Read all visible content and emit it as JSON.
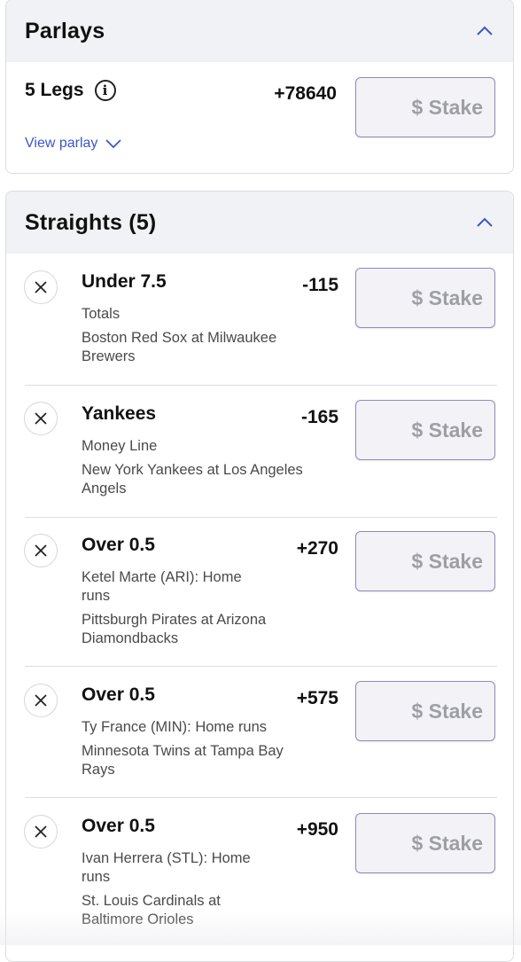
{
  "parlays": {
    "title": "Parlays",
    "legs_label": "5 Legs",
    "info_glyph": "i",
    "odds": "+78640",
    "stake_placeholder": "$ Stake",
    "view_parlay_label": "View parlay"
  },
  "straights": {
    "title": "Straights (5)",
    "bets": [
      {
        "selection": "Under 7.5",
        "market": "Totals",
        "event": "Boston Red Sox at Milwaukee Brewers",
        "odds": "-115",
        "stake_placeholder": "$ Stake"
      },
      {
        "selection": "Yankees",
        "market": "Money Line",
        "event": "New York Yankees at Los Angeles Angels",
        "odds": "-165",
        "stake_placeholder": "$ Stake"
      },
      {
        "selection": "Over 0.5",
        "market": "Ketel Marte (ARI): Home runs",
        "event": "Pittsburgh Pirates at Arizona Diamondbacks",
        "odds": "+270",
        "stake_placeholder": "$ Stake"
      },
      {
        "selection": "Over 0.5",
        "market": "Ty France (MIN): Home runs",
        "event": "Minnesota Twins at Tampa Bay Rays",
        "odds": "+575",
        "stake_placeholder": "$ Stake"
      },
      {
        "selection": "Over 0.5",
        "market": "Ivan Herrera (STL): Home runs",
        "event": "St. Louis Cardinals at Baltimore Orioles",
        "odds": "+950",
        "stake_placeholder": "$ Stake"
      }
    ]
  },
  "colors": {
    "header_bg": "#f1f2f5",
    "accent_link": "#3c56c8",
    "stake_border": "#8f8ab8"
  },
  "icons": {
    "collapse": "chevron-up-icon",
    "expand": "chevron-down-icon",
    "remove": "close-icon",
    "info": "info-icon"
  }
}
